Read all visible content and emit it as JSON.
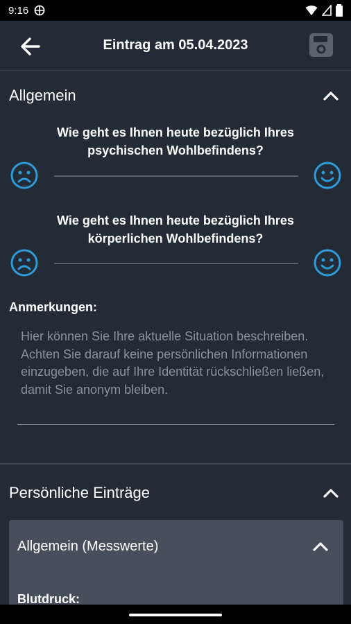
{
  "status_bar": {
    "time": "9:16",
    "icons": [
      "vpn-icon",
      "wifi-icon",
      "signal-icon",
      "battery-icon"
    ]
  },
  "app_bar": {
    "title": "Eintrag am 05.04.2023",
    "back_icon": "arrow-left-icon",
    "save_icon": "save-icon"
  },
  "section_general": {
    "title": "Allgemein",
    "questions": [
      {
        "text_line1": "Wie geht es Ihnen heute bezüglich Ihres",
        "text_line2": "psychischen Wohlbefindens?"
      },
      {
        "text_line1": "Wie geht es Ihnen heute bezüglich Ihres",
        "text_line2": "körperlichen Wohlbefindens?"
      }
    ],
    "notes_label": "Anmerkungen:",
    "notes_placeholder": "Hier können Sie Ihre aktuelle Situation beschreiben. Achten Sie darauf keine persönlichen Informationen einzugeben, die auf Ihre Identität rückschließen ließen, damit Sie anonym bleiben."
  },
  "section_personal": {
    "title": "Persönliche Einträge",
    "card": {
      "title": "Allgemein (Messwerte)",
      "subtitle": "Blutdruck:"
    }
  },
  "colors": {
    "background": "#232b37",
    "accent": "#2f9bd6",
    "card": "#474f5c"
  }
}
